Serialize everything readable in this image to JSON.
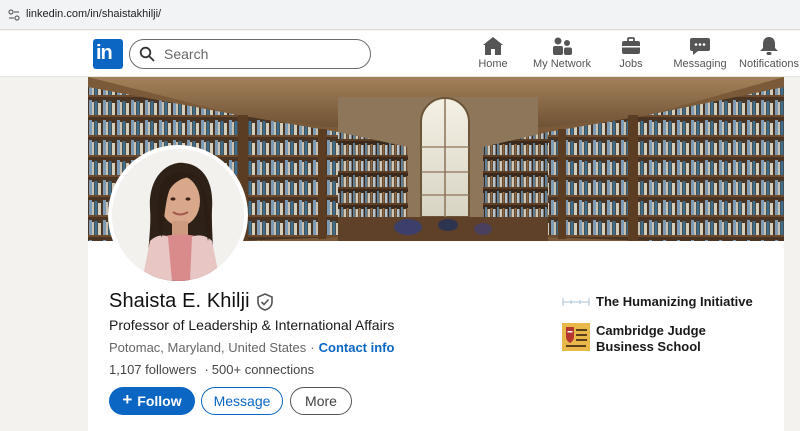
{
  "browser": {
    "url": "linkedin.com/in/shaistakhilji/"
  },
  "nav": {
    "logo_text": "in",
    "search_placeholder": "Search",
    "items": [
      {
        "label": "Home",
        "icon": "home-icon"
      },
      {
        "label": "My Network",
        "icon": "network-icon"
      },
      {
        "label": "Jobs",
        "icon": "briefcase-icon"
      },
      {
        "label": "Messaging",
        "icon": "chat-icon"
      },
      {
        "label": "Notifications",
        "icon": "bell-icon"
      }
    ]
  },
  "profile": {
    "name": "Shaista E. Khilji",
    "headline": "Professor of Leadership & International Affairs",
    "location": "Potomac, Maryland, United States",
    "separator": "·",
    "contact_label": "Contact info",
    "followers": "1,107 followers",
    "connections": "500+ connections",
    "buttons": {
      "follow": "Follow",
      "message": "Message",
      "more": "More"
    }
  },
  "organizations": [
    {
      "name": "The Humanizing Initiative"
    },
    {
      "name": "Cambridge Judge Business School"
    }
  ],
  "colors": {
    "linkedin_blue": "#0a66c2",
    "page_bg": "#f4f2ee"
  }
}
